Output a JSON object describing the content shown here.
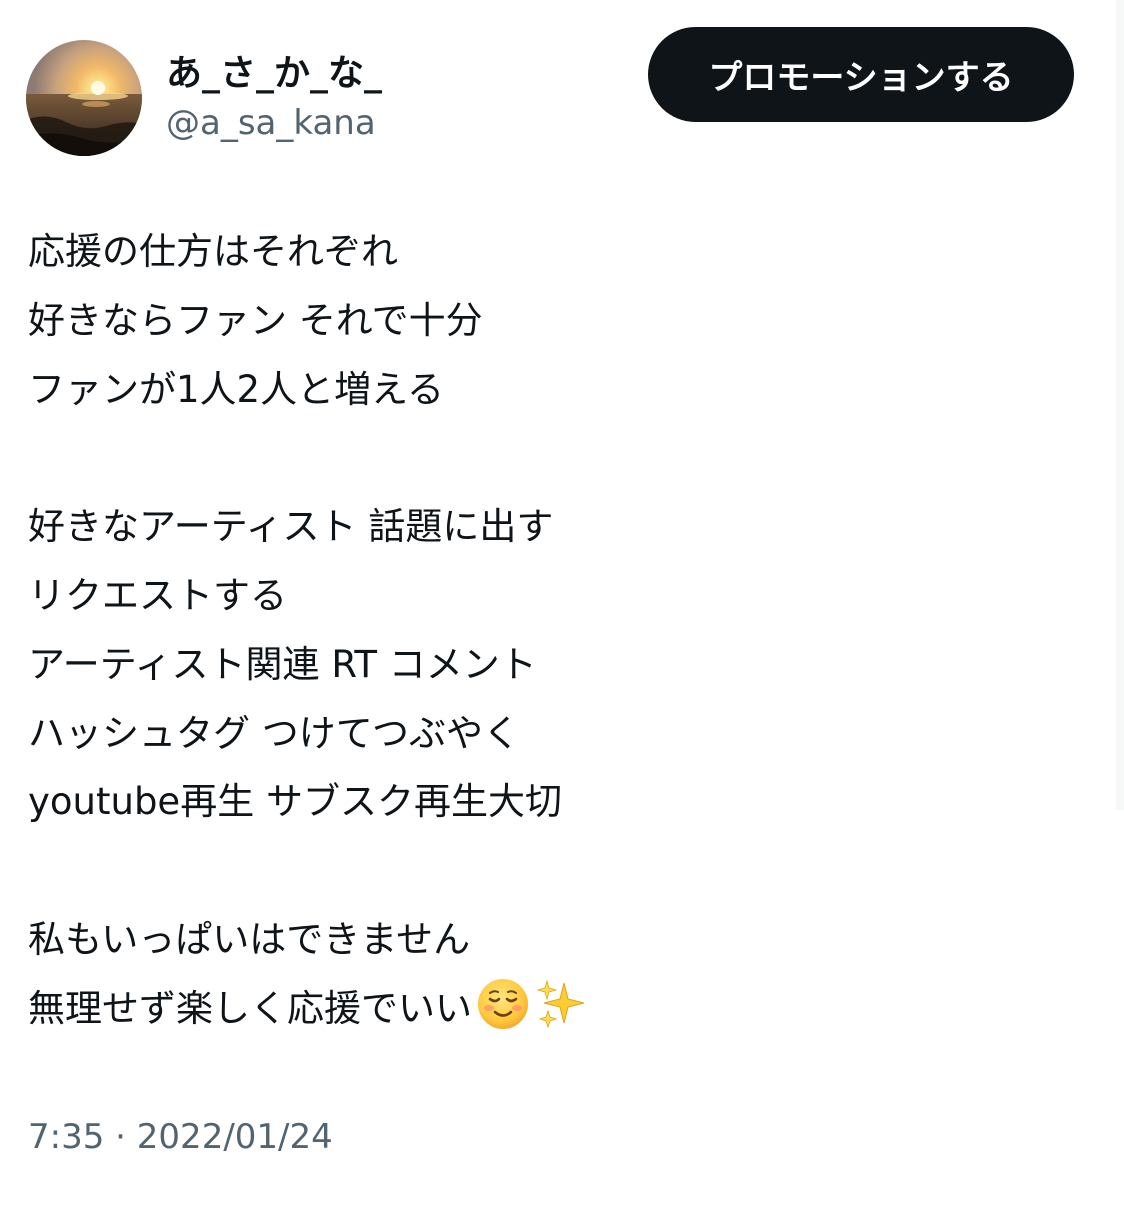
{
  "author": {
    "display_name": "あ_さ_か_な_",
    "handle": "@a_sa_kana",
    "avatar": "sunset-over-sea-photo"
  },
  "actions": {
    "promote_label": "プロモーションする"
  },
  "tweet": {
    "lines": [
      "応援の仕方はそれぞれ",
      "好きならファン それで十分",
      "ファンが1人2人と増える",
      "",
      "好きなアーティスト 話題に出す",
      "リクエストする",
      "アーティスト関連 RT コメント",
      "ハッシュタグ つけてつぶやく",
      "youtube再生 サブスク再生大切",
      "",
      "私もいっぱいはできません",
      "無理せず楽しく応援でいい"
    ],
    "emojis": [
      "smiling-face-icon",
      "sparkles-icon"
    ]
  },
  "meta": {
    "time": "7:35",
    "separator": "·",
    "date": "2022/01/24"
  },
  "colors": {
    "button_bg": "#0f1419",
    "secondary_text": "#536471",
    "primary_text": "#0f1419"
  }
}
